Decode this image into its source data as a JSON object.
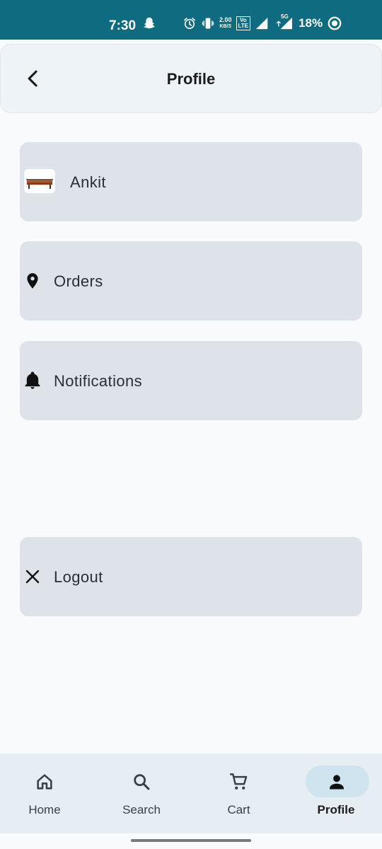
{
  "status_bar": {
    "time": "7:30",
    "net_speed_value": "2.00",
    "net_speed_unit": "KB/S",
    "volte_top": "Vo",
    "volte_bottom": "LTE",
    "network": "5G",
    "battery": "18%",
    "icons": [
      "snapchat-icon",
      "alarm-icon",
      "vibrate-icon",
      "signal-icon",
      "battery-icon"
    ]
  },
  "app_bar": {
    "title": "Profile",
    "back_icon": "chevron-left-icon"
  },
  "menu": {
    "profile_name": "Ankit",
    "orders_label": "Orders",
    "notifications_label": "Notifications",
    "logout_label": "Logout",
    "icons": {
      "orders": "location-pin-icon",
      "notifications": "bell-icon",
      "logout": "close-icon"
    }
  },
  "bottom_nav": {
    "items": [
      {
        "label": "Home",
        "icon": "home-icon"
      },
      {
        "label": "Search",
        "icon": "search-icon"
      },
      {
        "label": "Cart",
        "icon": "cart-icon"
      },
      {
        "label": "Profile",
        "icon": "person-icon"
      }
    ],
    "active_index": 3
  },
  "colors": {
    "status_bar": "#0f6b7f",
    "card": "#dde3e9",
    "active_pill": "#cfe4ee"
  }
}
